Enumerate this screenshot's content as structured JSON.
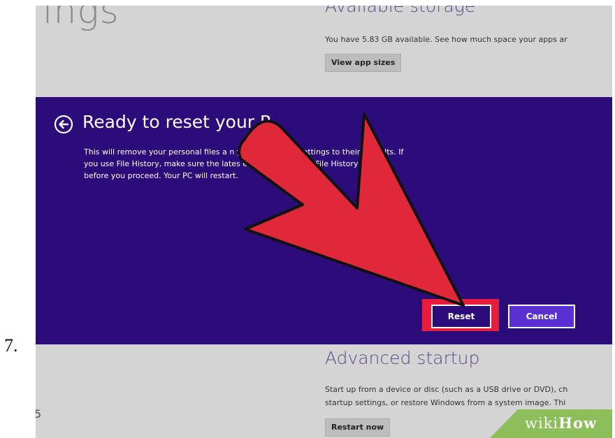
{
  "step": {
    "number": "7."
  },
  "background": {
    "title_fragment": "ings",
    "side_digit": "5",
    "storage": {
      "heading": "Available storage",
      "body": "You have 5.83 GB available. See how much space your apps ar",
      "button": "View app sizes"
    },
    "advanced": {
      "heading": "Advanced startup",
      "body_lines": [
        "Start up from a device or disc (such as a USB drive or DVD), ch",
        "startup settings, or restore Windows from a system image. Thi"
      ],
      "button": "Restart now"
    }
  },
  "dialog": {
    "title": "Ready to reset your P",
    "message_lines": [
      "This will remove your personal files a           n you        l restore all settings to their defaults. If",
      "you use File History, make sure the lates                     ere copied to your File History drive",
      "before you proceed. Your PC will restart."
    ],
    "reset_label": "Reset",
    "cancel_label": "Cancel"
  },
  "watermark": {
    "wiki": "wiki",
    "how": "How"
  },
  "colors": {
    "panel": "#2b0c7a",
    "highlight": "#e81c3c",
    "cancel_fill": "#5a2fd3",
    "arrow_fill": "#e0283a",
    "badge": "#8cbf59"
  },
  "icons": {
    "back": "back-arrow-circle-icon",
    "pointer": "red-pointer-arrow"
  }
}
